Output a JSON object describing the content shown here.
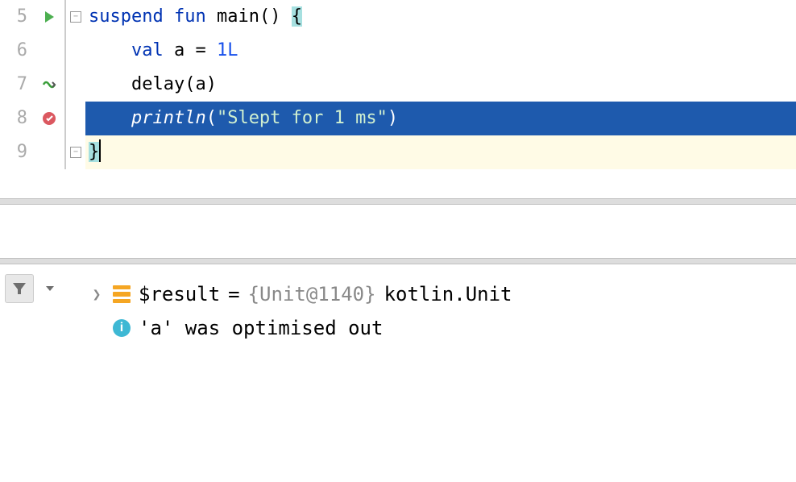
{
  "editor": {
    "lines": [
      {
        "num": "5"
      },
      {
        "num": "6"
      },
      {
        "num": "7"
      },
      {
        "num": "8"
      },
      {
        "num": "9"
      }
    ],
    "code": {
      "l5_kw1": "suspend",
      "l5_kw2": "fun",
      "l5_fn": "main",
      "l5_paren": "()",
      "l5_brace": "{",
      "l6_kw": "val",
      "l6_var": "a =",
      "l6_lit": "1L",
      "l7_call": "delay(a)",
      "l8_fn": "println",
      "l8_open": "(",
      "l8_str": "\"Slept for 1 ms\"",
      "l8_close": ")",
      "l9_brace": "}"
    }
  },
  "variables": {
    "result_name": "$result",
    "result_eq": " = ",
    "result_obj": "{Unit@1140}",
    "result_type": " kotlin.Unit",
    "optimised": "'a' was optimised out"
  }
}
